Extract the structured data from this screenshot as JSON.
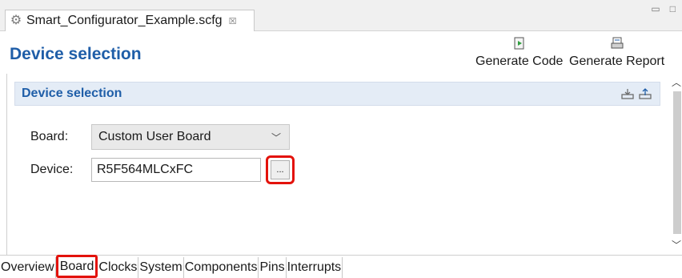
{
  "editor": {
    "tab_label": "Smart_Configurator_Example.scfg",
    "tab_close": "☒"
  },
  "header": {
    "title": "Device selection",
    "generate_code": "Generate Code",
    "generate_report": "Generate Report"
  },
  "section": {
    "title": "Device selection",
    "board_label": "Board:",
    "board_value": "Custom User Board",
    "device_label": "Device:",
    "device_value": "R5F564MLCxFC",
    "browse_label": "..."
  },
  "bottom_tabs": [
    "Overview",
    "Board",
    "Clocks",
    "System",
    "Components",
    "Pins",
    "Interrupts"
  ],
  "colors": {
    "accent": "#1f5ea8",
    "highlight": "#e3120b"
  }
}
